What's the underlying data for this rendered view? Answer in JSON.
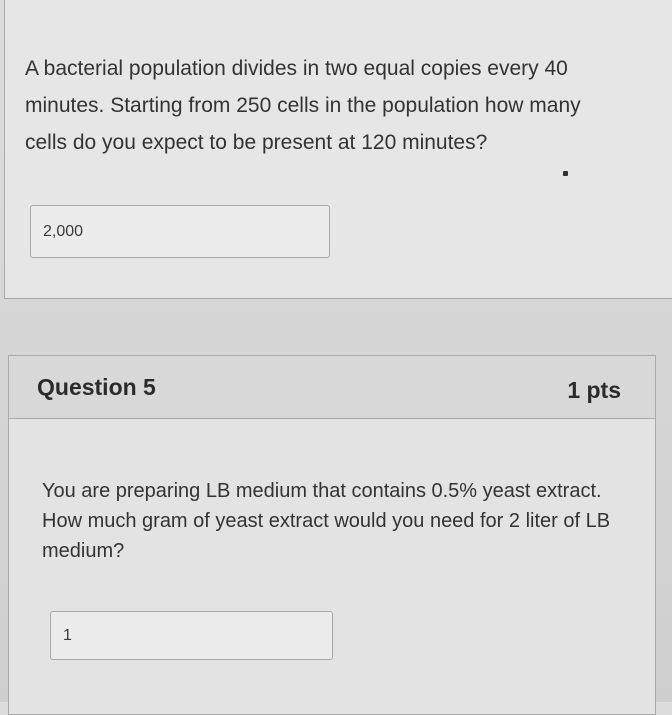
{
  "question_4": {
    "text": "A bacterial population divides in two equal copies every 40 minutes. Starting from 250 cells in the population how many cells do you expect to be present at 120 minutes?",
    "answer_value": "2,000"
  },
  "question_5": {
    "title": "Question 5",
    "points": "1 pts",
    "text": "You are preparing LB medium that contains 0.5% yeast extract. How much gram of yeast extract would you need for 2 liter of LB medium?",
    "answer_value": "1"
  }
}
